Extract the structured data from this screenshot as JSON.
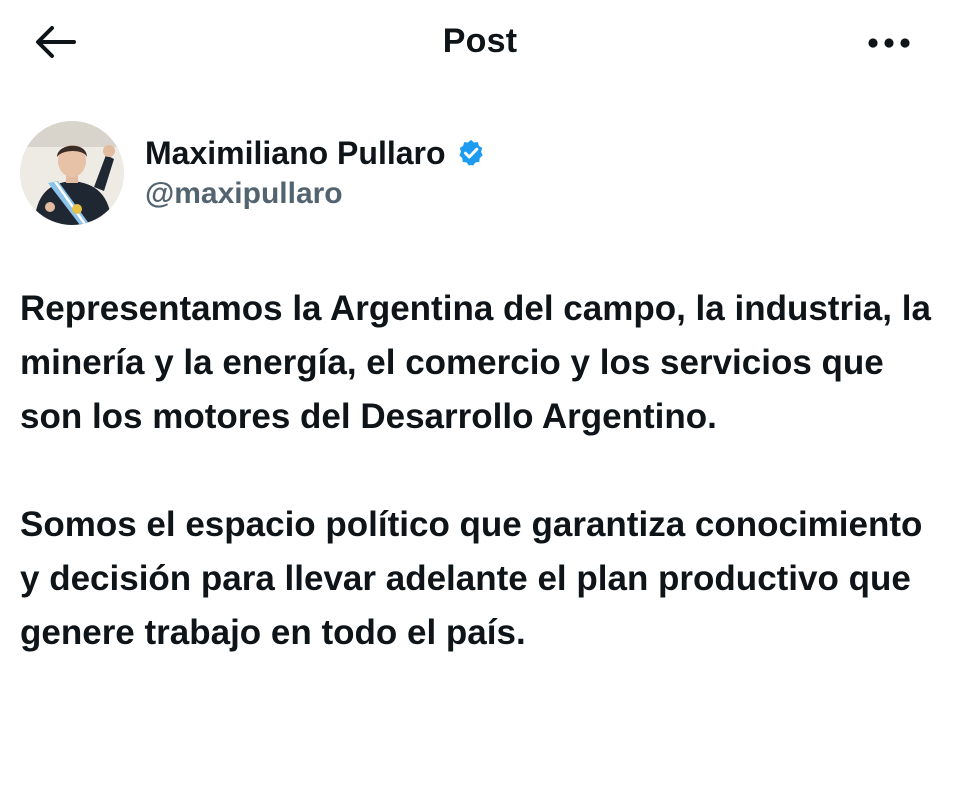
{
  "header": {
    "title": "Post"
  },
  "author": {
    "display_name": "Maximiliano Pullaro",
    "handle": "@maxipullaro",
    "verified_color": "#1d9bf0"
  },
  "post": {
    "paragraphs": [
      "Representamos la Argentina del campo, la industria, la minería y la energía, el comercio y los servicios que son los motores del Desarrollo Argentino.",
      "Somos el espacio político que garantiza conocimiento y decisión para llevar adelante el plan productivo que genere trabajo en todo el país."
    ]
  },
  "icons": {
    "back": "arrow-left-icon",
    "more": "more-horizontal-icon",
    "verified": "verified-badge-icon"
  }
}
